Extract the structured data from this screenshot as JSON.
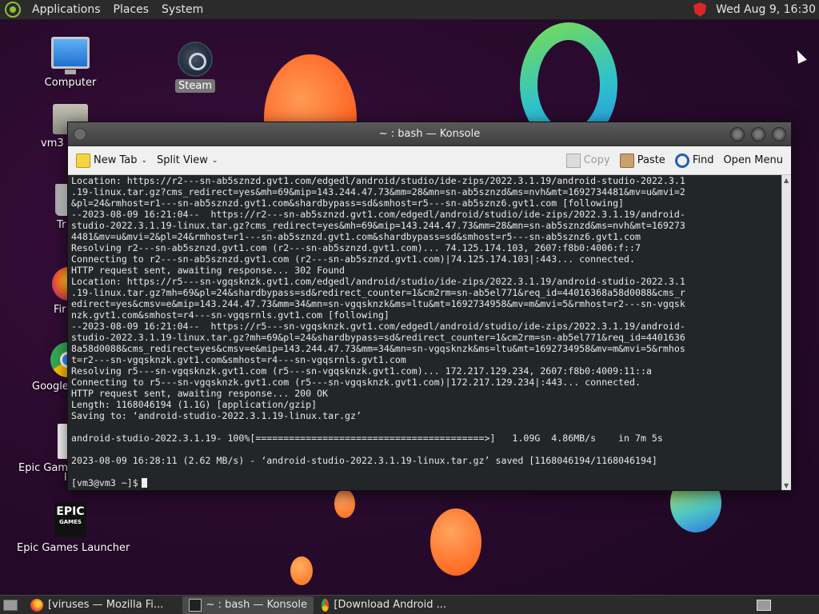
{
  "top_panel": {
    "menus": [
      "Applications",
      "Places",
      "System"
    ],
    "clock": "Wed Aug  9, 16:30"
  },
  "desktop_icons": {
    "computer": "Computer",
    "steam": "Steam",
    "home": "vm3",
    "trash": "Tr",
    "firefox": "Fir",
    "chrome": "Google",
    "epic_games_doc": "Epic Game",
    "epic_games_doc_line2": "l",
    "epic_launcher": "Epic Games Launcher",
    "epic_logo_top": "EPIC",
    "epic_logo_bottom": "GAMES"
  },
  "konsole": {
    "title": "~ : bash — Konsole",
    "toolbar": {
      "new_tab": "New Tab",
      "split_view": "Split View",
      "copy": "Copy",
      "paste": "Paste",
      "find": "Find",
      "open_menu": "Open Menu"
    },
    "lines": [
      "Location: https://r2---sn-ab5sznzd.gvt1.com/edgedl/android/studio/ide-zips/2022.3.1.19/android-studio-2022.3.1",
      ".19-linux.tar.gz?cms_redirect=yes&mh=69&mip=143.244.47.73&mm=28&mn=sn-ab5sznzd&ms=nvh&mt=1692734481&mv=u&mvi=2",
      "&pl=24&rmhost=r1---sn-ab5sznzd.gvt1.com&shardbypass=sd&smhost=r5---sn-ab5sznz6.gvt1.com [following]",
      "--2023-08-09 16:21:04--  https://r2---sn-ab5sznzd.gvt1.com/edgedl/android/studio/ide-zips/2022.3.1.19/android-",
      "studio-2022.3.1.19-linux.tar.gz?cms_redirect=yes&mh=69&mip=143.244.47.73&mm=28&mn=sn-ab5sznzd&ms=nvh&mt=169273",
      "4481&mv=u&mvi=2&pl=24&rmhost=r1---sn-ab5sznzd.gvt1.com&shardbypass=sd&smhost=r5---sn-ab5sznz6.gvt1.com",
      "Resolving r2---sn-ab5sznzd.gvt1.com (r2---sn-ab5sznzd.gvt1.com)... 74.125.174.103, 2607:f8b0:4006:f::7",
      "Connecting to r2---sn-ab5sznzd.gvt1.com (r2---sn-ab5sznzd.gvt1.com)|74.125.174.103|:443... connected.",
      "HTTP request sent, awaiting response... 302 Found",
      "Location: https://r5---sn-vgqsknzk.gvt1.com/edgedl/android/studio/ide-zips/2022.3.1.19/android-studio-2022.3.1",
      ".19-linux.tar.gz?mh=69&pl=24&shardbypass=sd&redirect_counter=1&cm2rm=sn-ab5el771&req_id=44016368a58d0088&cms_r",
      "edirect=yes&cmsv=e&mip=143.244.47.73&mm=34&mn=sn-vgqsknzk&ms=ltu&mt=1692734958&mv=m&mvi=5&rmhost=r2---sn-vgqsk",
      "nzk.gvt1.com&smhost=r4---sn-vgqsrnls.gvt1.com [following]",
      "--2023-08-09 16:21:04--  https://r5---sn-vgqsknzk.gvt1.com/edgedl/android/studio/ide-zips/2022.3.1.19/android-",
      "studio-2022.3.1.19-linux.tar.gz?mh=69&pl=24&shardbypass=sd&redirect_counter=1&cm2rm=sn-ab5el771&req_id=4401636",
      "8a58d0088&cms_redirect=yes&cmsv=e&mip=143.244.47.73&mm=34&mn=sn-vgqsknzk&ms=ltu&mt=1692734958&mv=m&mvi=5&rmhos",
      "t=r2---sn-vgqsknzk.gvt1.com&smhost=r4---sn-vgqsrnls.gvt1.com",
      "Resolving r5---sn-vgqsknzk.gvt1.com (r5---sn-vgqsknzk.gvt1.com)... 172.217.129.234, 2607:f8b0:4009:11::a",
      "Connecting to r5---sn-vgqsknzk.gvt1.com (r5---sn-vgqsknzk.gvt1.com)|172.217.129.234|:443... connected.",
      "HTTP request sent, awaiting response... 200 OK",
      "Length: 1168046194 (1.1G) [application/gzip]",
      "Saving to: ‘android-studio-2022.3.1.19-linux.tar.gz’",
      "",
      "android-studio-2022.3.1.19- 100%[=========================================>]   1.09G  4.86MB/s    in 7m 5s",
      "",
      "2023-08-09 16:28:11 (2.62 MB/s) - ‘android-studio-2022.3.1.19-linux.tar.gz’ saved [1168046194/1168046194]",
      ""
    ],
    "prompt": "[vm3@vm3 ~]$"
  },
  "taskbar": {
    "tasks": [
      "[viruses — Mozilla Fi...",
      "~ : bash — Konsole",
      "[Download Android ..."
    ]
  }
}
